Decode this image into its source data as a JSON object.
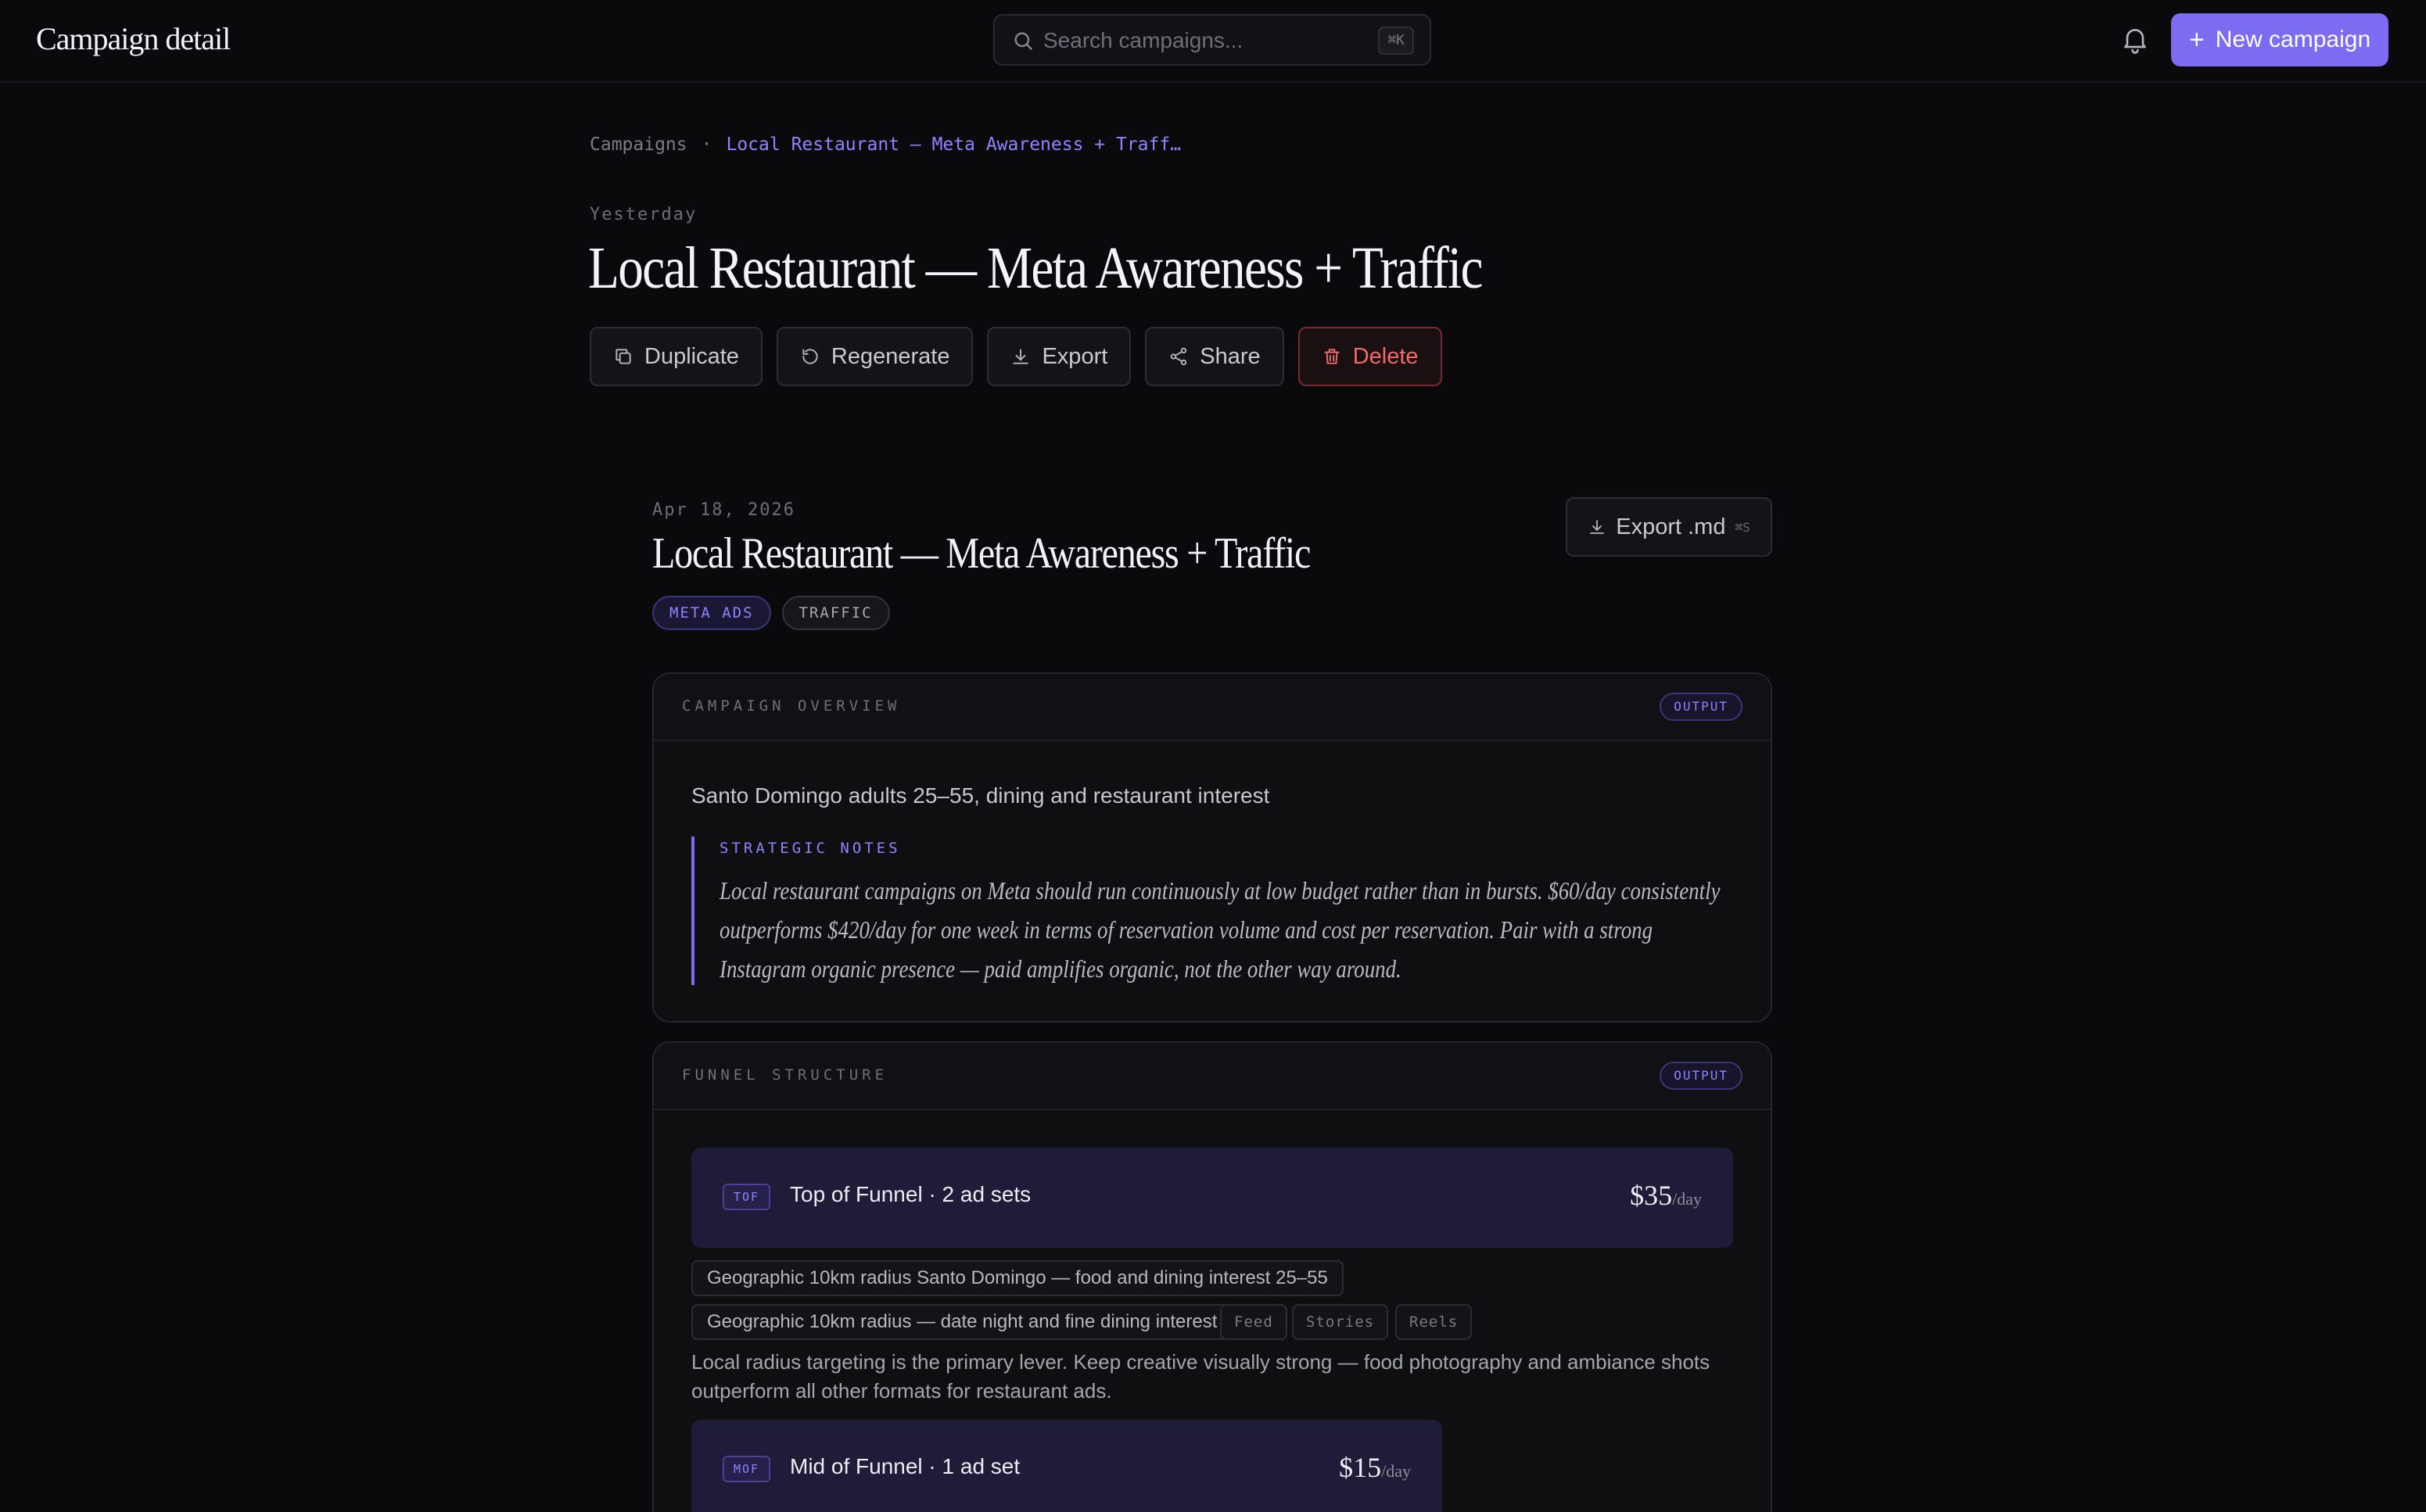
{
  "app": {
    "title": "Campaign detail",
    "search_placeholder": "Search campaigns...",
    "search_shortcut": "⌘K",
    "new_campaign_label": "New campaign"
  },
  "breadcrumb": {
    "root": "Campaigns",
    "separator": "·",
    "current": "Local Restaurant — Meta Awareness + Traff…"
  },
  "header": {
    "date": "Yesterday",
    "title": "Local Restaurant — Meta Awareness + Traffic",
    "actions": {
      "duplicate": "Duplicate",
      "regenerate": "Regenerate",
      "export": "Export",
      "share": "Share",
      "delete": "Delete"
    }
  },
  "document": {
    "date": "Apr 18, 2026",
    "title": "Local Restaurant — Meta Awareness + Traffic",
    "tags": [
      "META ADS",
      "TRAFFIC"
    ],
    "export_md_label": "Export .md",
    "export_md_shortcut": "⌘S"
  },
  "overview": {
    "label": "CAMPAIGN OVERVIEW",
    "badge": "OUTPUT",
    "audience": "Santo Domingo adults 25–55, dining and restaurant interest",
    "notes_label": "STRATEGIC NOTES",
    "notes": "Local restaurant campaigns on Meta should run continuously at low budget rather than in bursts. $60/day consistently outperforms $420/day for one week in terms of reservation volume and cost per reservation. Pair with a strong Instagram organic presence — paid amplifies organic, not the other way around."
  },
  "funnel": {
    "label": "FUNNEL STRUCTURE",
    "badge": "OUTPUT",
    "tof": {
      "stage": "TOF",
      "name": "Top of Funnel · 2 ad sets",
      "budget": "$35",
      "per": "/day",
      "ad_sets": [
        "Geographic 10km radius Santo Domingo — food and dining interest 25–55",
        "Geographic 10km radius — date night and fine dining interest"
      ],
      "placements": [
        "Feed",
        "Stories",
        "Reels"
      ],
      "note": "Local radius targeting is the primary lever. Keep creative visually strong — food photography and ambiance shots outperform all other formats for restaurant ads."
    },
    "mof": {
      "stage": "MOF",
      "name": "Mid of Funnel · 1 ad set",
      "budget": "$15",
      "per": "/day"
    }
  },
  "colors": {
    "accent": "#7b6cf2",
    "background": "#0a0a0c",
    "danger": "#f06a6a"
  }
}
